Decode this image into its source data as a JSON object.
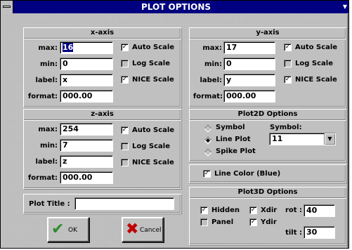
{
  "window": {
    "title": "PLOT OPTIONS"
  },
  "xaxis": {
    "title": "x-axis",
    "max_label": "max:",
    "max_value": "16",
    "min_label": "min:",
    "min_value": "0",
    "label_label": "label:",
    "label_value": "x",
    "format_label": "format:",
    "format_value": "000.00",
    "auto_scale": "Auto Scale",
    "log_scale": "Log Scale",
    "nice_scale": "NICE Scale",
    "auto_checked": "✓",
    "log_checked": "",
    "nice_checked": "✓"
  },
  "yaxis": {
    "title": "y-axis",
    "max_label": "max:",
    "max_value": "17",
    "min_label": "min:",
    "min_value": "0",
    "label_label": "label:",
    "label_value": "y",
    "format_label": "format:",
    "format_value": "000.00",
    "auto_scale": "Auto Scale",
    "log_scale": "Log Scale",
    "nice_scale": "NICE Scale",
    "auto_checked": "✓",
    "log_checked": "",
    "nice_checked": "✓"
  },
  "zaxis": {
    "title": "z-axis",
    "max_label": "max:",
    "max_value": "254",
    "min_label": "min:",
    "min_value": "7",
    "label_label": "label:",
    "label_value": "z",
    "format_label": "format:",
    "format_value": "000.00",
    "auto_scale": "Auto Scale",
    "log_scale": "Log Scale",
    "nice_scale": "NICE Scale",
    "auto_checked": "✓",
    "log_checked": "",
    "nice_checked": ""
  },
  "plot2d": {
    "title": "Plot2D Options",
    "symbol_label": "Symbol",
    "line_plot_label": "Line Plot",
    "spike_plot_label": "Spike Plot",
    "symbol_select_label": "Symbol:",
    "symbol_value": "11",
    "selected": "Line Plot"
  },
  "line_color": {
    "label": "Line Color (Blue)",
    "checked": "✓"
  },
  "plot3d": {
    "title": "Plot3D Options",
    "hidden_label": "Hidden",
    "hidden_checked": "✓",
    "panel_label": "Panel",
    "panel_checked": "",
    "xdir_label": "Xdir",
    "xdir_checked": "✓",
    "ydir_label": "Ydir",
    "ydir_checked": "✓",
    "rot_label": "rot :",
    "rot_value": "40",
    "tilt_label": "tilt :",
    "tilt_value": "30"
  },
  "plot_title": {
    "label": "Plot Title :",
    "value": ""
  },
  "buttons": {
    "ok": "OK",
    "cancel": "Cancel"
  },
  "colors": {
    "titlebar": "#000080",
    "face": "#c0c0c0",
    "ok_check": "#2e8b2e",
    "cancel_x": "#c00000"
  },
  "icons": {
    "ok": "check-icon",
    "cancel": "x-icon",
    "system_menu": "system-menu-icon",
    "dropdown": "down-arrow-icon"
  }
}
